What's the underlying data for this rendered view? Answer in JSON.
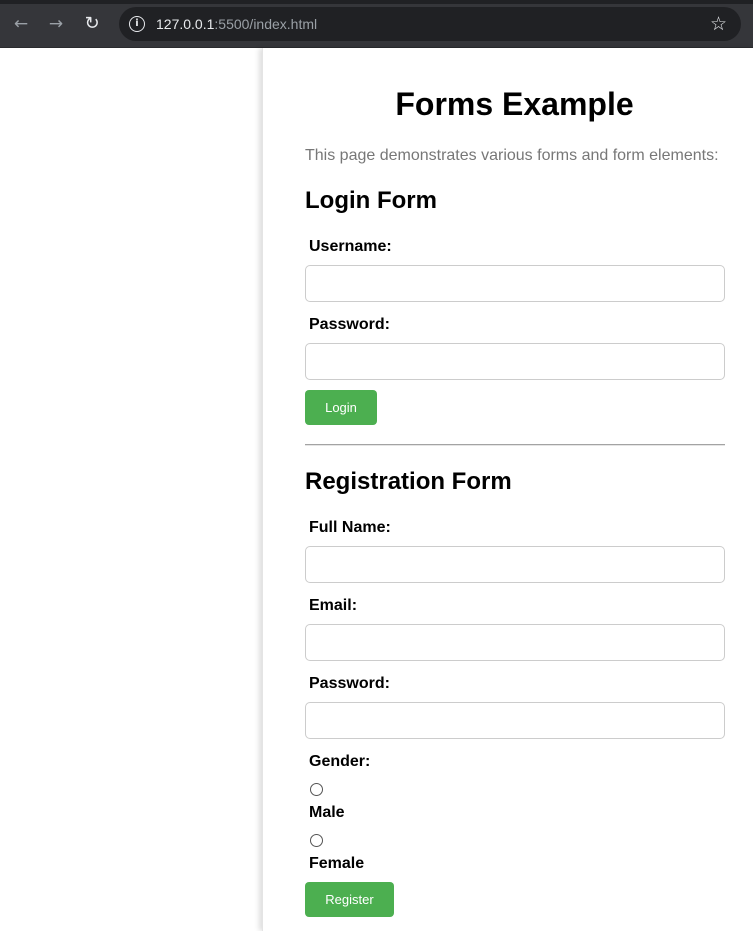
{
  "browser": {
    "url_host": "127.0.0.1",
    "url_rest": ":5500/index.html"
  },
  "page": {
    "title": "Forms Example",
    "intro": "This page demonstrates various forms and form elements:"
  },
  "login_form": {
    "heading": "Login Form",
    "username_label": "Username:",
    "username_value": "",
    "password_label": "Password:",
    "password_value": "",
    "submit_label": "Login"
  },
  "registration_form": {
    "heading": "Registration Form",
    "fullname_label": "Full Name:",
    "fullname_value": "",
    "email_label": "Email:",
    "email_value": "",
    "password_label": "Password:",
    "password_value": "",
    "gender_label": "Gender:",
    "gender_options": [
      "Male",
      "Female"
    ],
    "submit_label": "Register"
  },
  "colors": {
    "button_bg": "#4caf50",
    "intro_text": "#777777",
    "browser_bar": "#35363a"
  }
}
